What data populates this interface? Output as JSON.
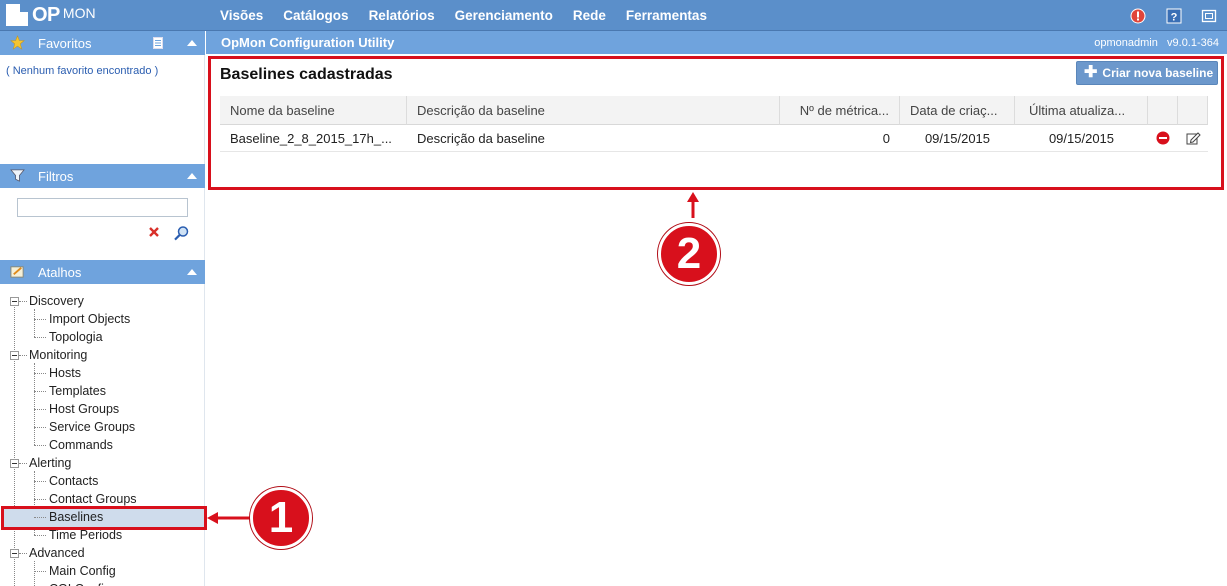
{
  "logo": {
    "text_op": "OP",
    "text_mon": "MON"
  },
  "menu": {
    "items": [
      "Visões",
      "Catálogos",
      "Relatórios",
      "Gerenciamento",
      "Rede",
      "Ferramentas"
    ]
  },
  "subbar": {
    "title": "OpMon Configuration Utility",
    "user": "opmonadmin",
    "version": "v9.0.1-364"
  },
  "sidebar": {
    "favorites": {
      "title": "Favoritos",
      "empty": "( Nenhum favorito encontrado )"
    },
    "filters": {
      "title": "Filtros",
      "input_value": ""
    },
    "shortcuts": {
      "title": "Atalhos",
      "tree": [
        {
          "label": "Discovery",
          "children": [
            "Import Objects",
            "Topologia"
          ]
        },
        {
          "label": "Monitoring",
          "children": [
            "Hosts",
            "Templates",
            "Host Groups",
            "Service Groups",
            "Commands"
          ]
        },
        {
          "label": "Alerting",
          "children": [
            "Contacts",
            "Contact Groups",
            "Baselines",
            "Time Periods"
          ]
        },
        {
          "label": "Advanced",
          "children": [
            "Main Config",
            "CGI Config"
          ]
        }
      ],
      "selected": "Baselines"
    }
  },
  "main": {
    "heading": "Baselines cadastradas",
    "new_button": "Criar nova baseline",
    "columns": [
      "Nome da baseline",
      "Descrição da baseline",
      "Nº de métrica...",
      "Data de criaç...",
      "Última atualiza..."
    ],
    "rows": [
      {
        "name": "Baseline_2_8_2015_17h_...",
        "description": "Descrição da baseline",
        "metrics": "0",
        "created": "09/15/2015",
        "updated": "09/15/2015"
      }
    ]
  },
  "annotations": {
    "callout1": "1",
    "callout2": "2"
  },
  "colors": {
    "topbar": "#5b8fca",
    "panel_header": "#6fa3dd",
    "accent_red": "#d8101c",
    "button": "#6c98cc"
  }
}
